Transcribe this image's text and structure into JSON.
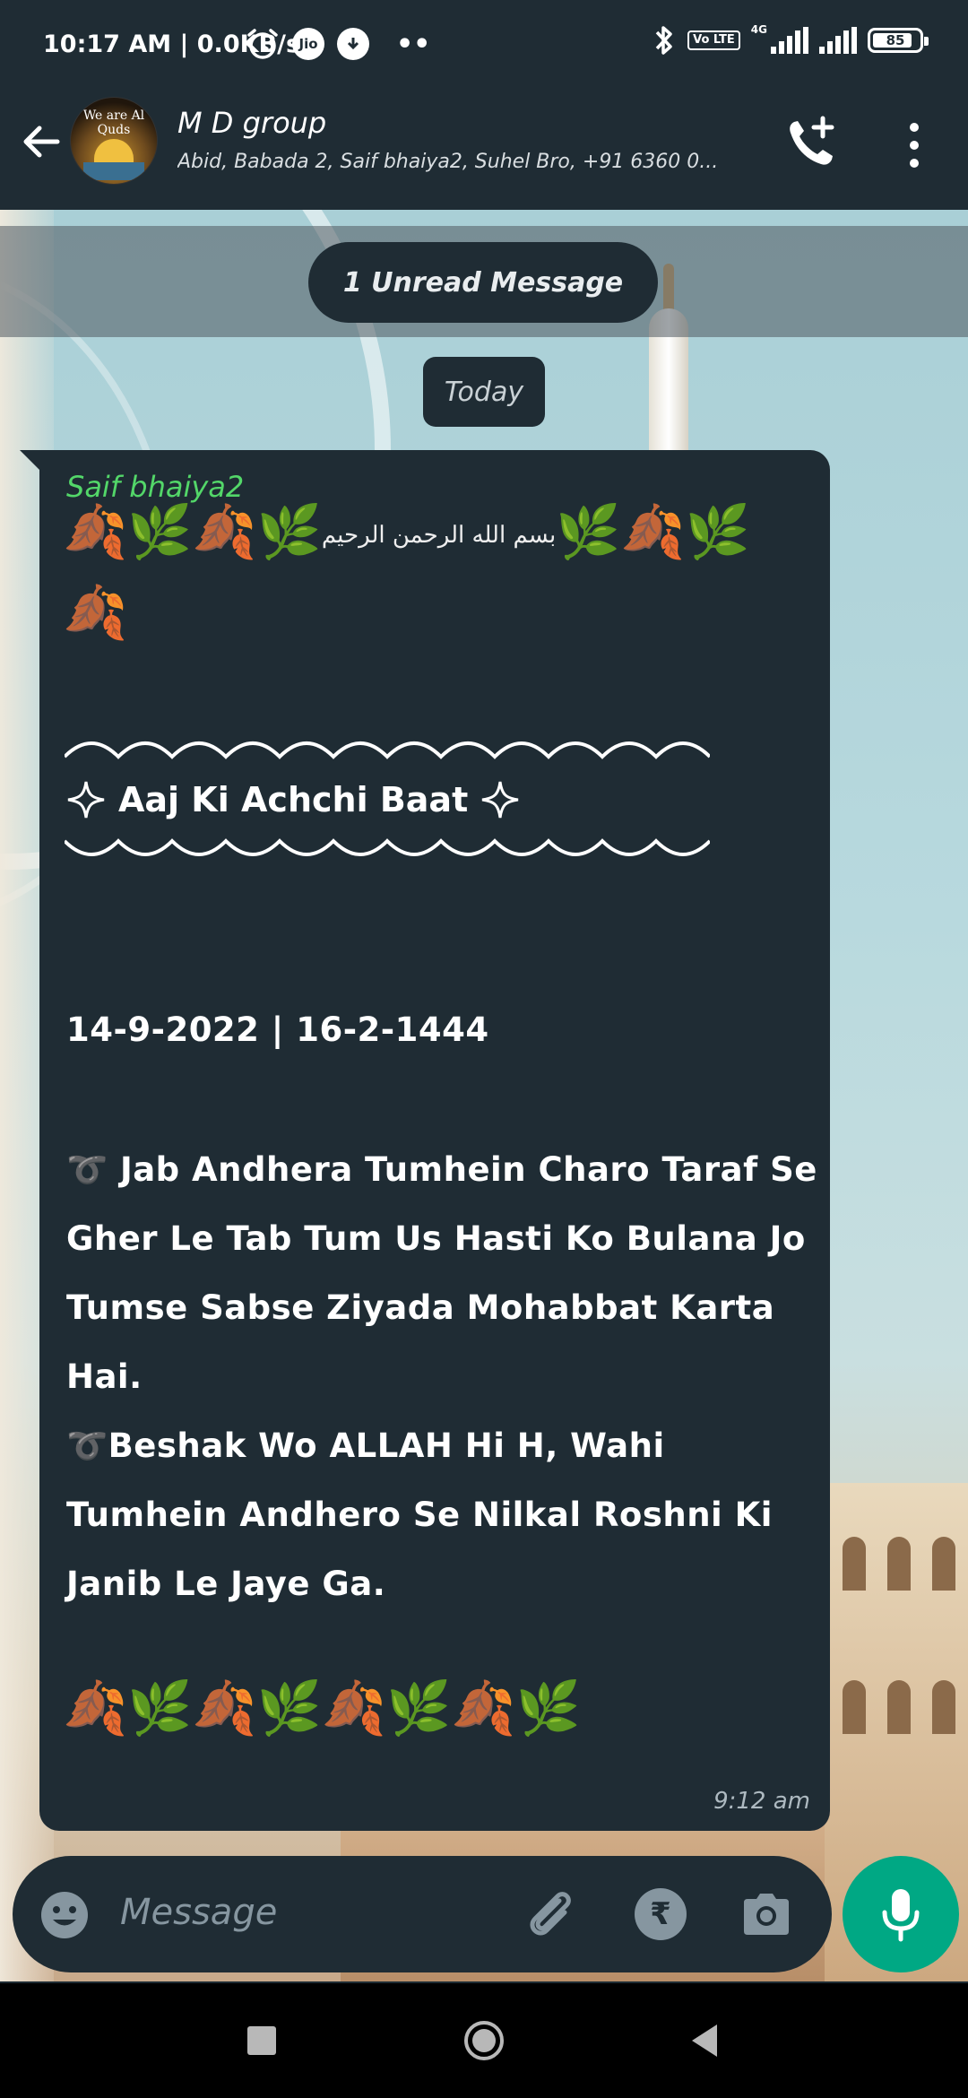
{
  "status_bar": {
    "time": "10:17 AM | 0.0KB/s",
    "jio_label": "Jio",
    "volte": "Vo LTE",
    "network": "4G",
    "battery": "85",
    "battery_level": 0.85
  },
  "header": {
    "avatar_text": "We are Al Quds",
    "title": "M D group",
    "subtitle": "Abid, Babada 2, Saif bhaiya2, Suhel Bro, +91 6360 0..."
  },
  "banner": {
    "unread": "1 Unread Message",
    "date": "Today"
  },
  "message": {
    "sender": "Saif bhaiya2",
    "emoji_row_1": "🍂🌿🍂🌿",
    "bismillah": "بسم الله الرحمن الرحيم",
    "emoji_row_1_after": "🌿🍂🌿",
    "emoji_row_2": "🍂",
    "heading": "Aaj Ki Achchi Baat",
    "date_line": "14-9-2022 | 16-2-1444",
    "paragraph_1": "➰ Jab Andhera Tumhein Charo Taraf Se Gher Le Tab Tum Us Hasti Ko Bulana Jo Tumse Sabse Ziyada Mohabbat Karta Hai.",
    "paragraph_2": "➰Beshak Wo ALLAH Hi H, Wahi Tumhein Andhero Se Nilkal Roshni Ki Janib Le Jaye Ga.",
    "emoji_row_3": "🍂🌿🍂🌿🍂🌿🍂🌿",
    "time": "9:12 am"
  },
  "input": {
    "placeholder": "Message",
    "rupee_symbol": "₹"
  },
  "colors": {
    "bar": "#1f2c34",
    "accent_green": "#00a884",
    "sender_green": "#53d769"
  }
}
